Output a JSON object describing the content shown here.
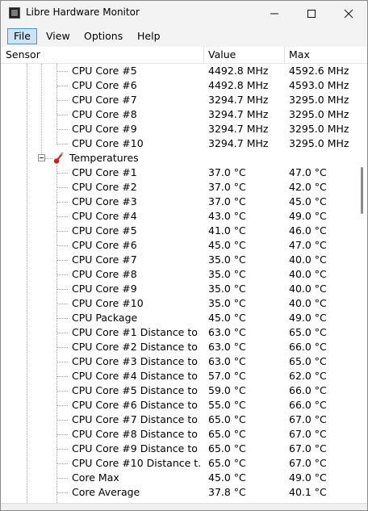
{
  "window": {
    "title": "Libre Hardware Monitor"
  },
  "menu": [
    {
      "label": "File",
      "active": true
    },
    {
      "label": "View"
    },
    {
      "label": "Options"
    },
    {
      "label": "Help"
    }
  ],
  "columns": {
    "sensor": "Sensor",
    "value": "Value",
    "max": "Max"
  },
  "clocks": [
    {
      "name": "CPU Core #5",
      "value": "4492.8 MHz",
      "max": "4592.6 MHz"
    },
    {
      "name": "CPU Core #6",
      "value": "4492.8 MHz",
      "max": "4593.0 MHz"
    },
    {
      "name": "CPU Core #7",
      "value": "3294.7 MHz",
      "max": "3295.0 MHz"
    },
    {
      "name": "CPU Core #8",
      "value": "3294.7 MHz",
      "max": "3295.0 MHz"
    },
    {
      "name": "CPU Core #9",
      "value": "3294.7 MHz",
      "max": "3295.0 MHz"
    },
    {
      "name": "CPU Core #10",
      "value": "3294.7 MHz",
      "max": "3295.0 MHz"
    }
  ],
  "temperatures": {
    "label": "Temperatures",
    "items": [
      {
        "name": "CPU Core #1",
        "value": "37.0 °C",
        "max": "47.0 °C"
      },
      {
        "name": "CPU Core #2",
        "value": "37.0 °C",
        "max": "42.0 °C"
      },
      {
        "name": "CPU Core #3",
        "value": "37.0 °C",
        "max": "45.0 °C"
      },
      {
        "name": "CPU Core #4",
        "value": "43.0 °C",
        "max": "49.0 °C"
      },
      {
        "name": "CPU Core #5",
        "value": "41.0 °C",
        "max": "46.0 °C"
      },
      {
        "name": "CPU Core #6",
        "value": "45.0 °C",
        "max": "47.0 °C"
      },
      {
        "name": "CPU Core #7",
        "value": "35.0 °C",
        "max": "40.0 °C"
      },
      {
        "name": "CPU Core #8",
        "value": "35.0 °C",
        "max": "40.0 °C"
      },
      {
        "name": "CPU Core #9",
        "value": "35.0 °C",
        "max": "40.0 °C"
      },
      {
        "name": "CPU Core #10",
        "value": "35.0 °C",
        "max": "40.0 °C"
      },
      {
        "name": "CPU Package",
        "value": "45.0 °C",
        "max": "49.0 °C"
      },
      {
        "name": "CPU Core #1 Distance to ...",
        "value": "63.0 °C",
        "max": "65.0 °C"
      },
      {
        "name": "CPU Core #2 Distance to ...",
        "value": "63.0 °C",
        "max": "66.0 °C"
      },
      {
        "name": "CPU Core #3 Distance to ...",
        "value": "63.0 °C",
        "max": "65.0 °C"
      },
      {
        "name": "CPU Core #4 Distance to ...",
        "value": "57.0 °C",
        "max": "62.0 °C"
      },
      {
        "name": "CPU Core #5 Distance to ...",
        "value": "59.0 °C",
        "max": "66.0 °C"
      },
      {
        "name": "CPU Core #6 Distance to ...",
        "value": "55.0 °C",
        "max": "66.0 °C"
      },
      {
        "name": "CPU Core #7 Distance to ...",
        "value": "65.0 °C",
        "max": "67.0 °C"
      },
      {
        "name": "CPU Core #8 Distance to ...",
        "value": "65.0 °C",
        "max": "67.0 °C"
      },
      {
        "name": "CPU Core #9 Distance to ...",
        "value": "65.0 °C",
        "max": "67.0 °C"
      },
      {
        "name": "CPU Core #10 Distance t...",
        "value": "65.0 °C",
        "max": "67.0 °C"
      },
      {
        "name": "Core Max",
        "value": "45.0 °C",
        "max": "49.0 °C"
      },
      {
        "name": "Core Average",
        "value": "37.8 °C",
        "max": "40.1 °C"
      }
    ]
  }
}
